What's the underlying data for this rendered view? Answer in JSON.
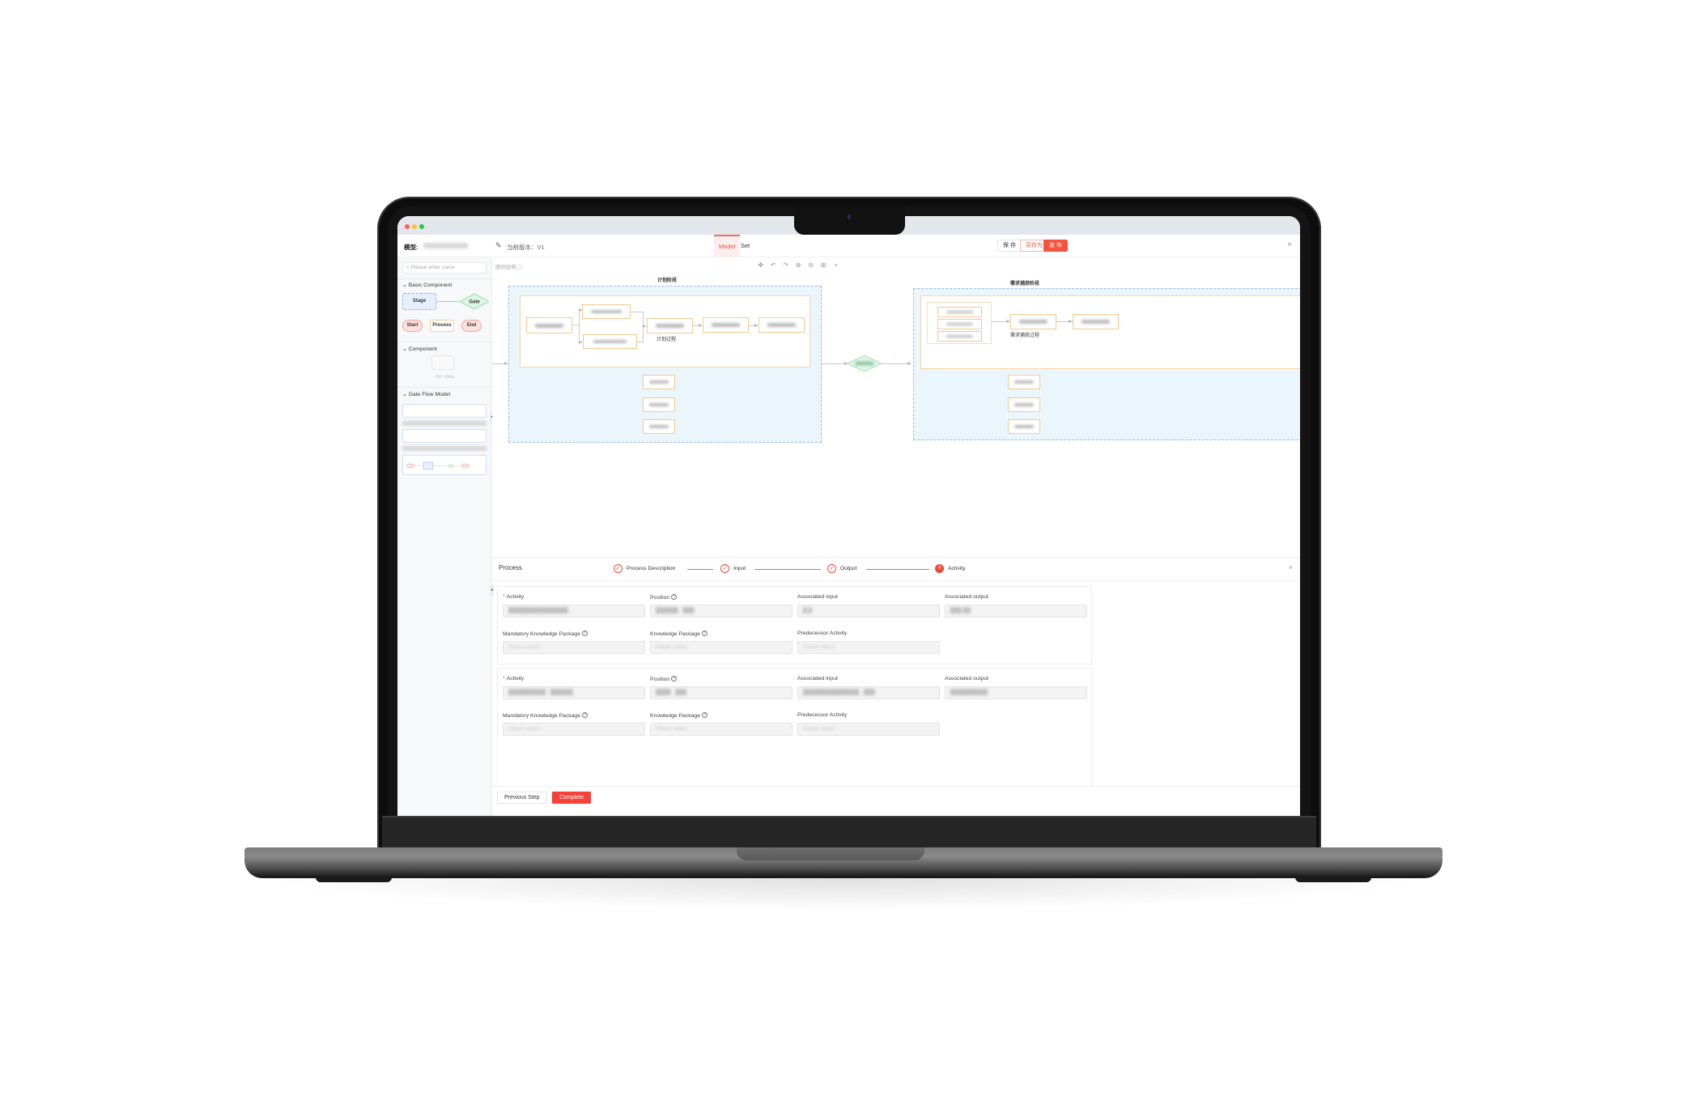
{
  "window": {
    "traffic_lights": [
      {
        "name": "close",
        "color": "#ff5f57"
      },
      {
        "name": "minimize",
        "color": "#febc2e"
      },
      {
        "name": "maximize",
        "color": "#28c840"
      }
    ]
  },
  "header": {
    "model_label": "模型:",
    "version_label": "当前版本：V1",
    "tabs": [
      {
        "label": "Model",
        "active": true
      },
      {
        "label": "Set",
        "active": false
      }
    ],
    "buttons": {
      "save": "保 存",
      "save_as": "另存为",
      "publish": "发 布"
    },
    "close_icon": "×",
    "edit_icon": "✎"
  },
  "sidebar": {
    "search_placeholder": "Please enter name",
    "search_icon": "⌕",
    "sections": {
      "basic": "Basic Component",
      "component": "Component",
      "gate_flow": "Gate Flow Model"
    },
    "basic_components": {
      "stage": "Stage",
      "gate": "Gate",
      "start": "Start",
      "process": "Process",
      "end": "End"
    },
    "component_empty": "No data",
    "chevron": "⌄"
  },
  "canvas": {
    "legend_label": "图例说明 ⓘ",
    "toolbar": [
      {
        "name": "move",
        "glyph": "✥"
      },
      {
        "name": "undo",
        "glyph": "↶"
      },
      {
        "name": "redo",
        "glyph": "↷"
      },
      {
        "name": "zoom-in",
        "glyph": "⊕"
      },
      {
        "name": "zoom-out",
        "glyph": "⊖"
      },
      {
        "name": "export",
        "glyph": "⊞"
      },
      {
        "name": "center",
        "glyph": "⌖"
      }
    ],
    "stages": [
      {
        "label": "计划阶段",
        "process_label": "计划过程"
      },
      {
        "label": "需求捕获阶段",
        "process_label": "需求捕获过程"
      }
    ]
  },
  "panel": {
    "title": "Process",
    "close_icon": "×",
    "steps": [
      {
        "label": "Process Description",
        "status": "done",
        "glyph": "✓"
      },
      {
        "label": "Input",
        "status": "done",
        "glyph": "✓"
      },
      {
        "label": "Output",
        "status": "done",
        "glyph": "✓"
      },
      {
        "label": "Activity",
        "status": "current",
        "glyph": "4"
      }
    ],
    "labels": {
      "activity": "Activity",
      "required_mark": "*",
      "position": "Position",
      "associated_input": "Associated input",
      "associated_output": "Associated output",
      "mandatory_kp": "Mandatory Knowledge Package",
      "kp": "Knowledge Package",
      "predecessor": "Predecessor Activity",
      "help_icon": "?"
    },
    "placeholder": "Please select",
    "activities": [
      {
        "activity": "████████████████",
        "position": "██████ · ███",
        "associated_input": "█ █",
        "associated_output": "███ ██",
        "mandatory_kp": "Please select",
        "kp": "Please select",
        "predecessor": "Please select"
      },
      {
        "activity": "██████████ · ██████",
        "position": "████ · ███",
        "associated_input": "███████████████ · ███",
        "associated_output": "██████████",
        "mandatory_kp": "Please select",
        "kp": "Please select",
        "predecessor": "Please select"
      }
    ],
    "footer": {
      "previous": "Previous Step",
      "complete": "Complete"
    }
  },
  "colors": {
    "accent": "#ee4b3b",
    "primary_button": "#f5413a",
    "stage_fill": "#ebf5fc",
    "node_border": "#f6c88f",
    "gate_fill": "#dcf5e4"
  }
}
